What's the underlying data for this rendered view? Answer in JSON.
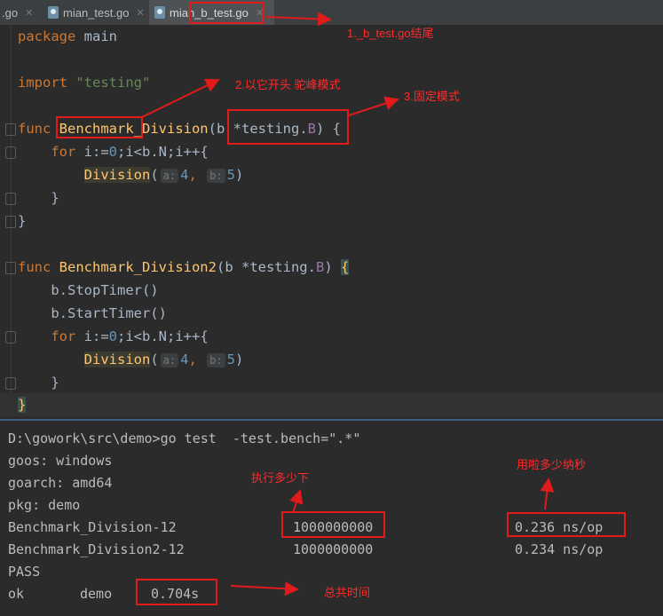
{
  "tabs": [
    {
      "label": ".go"
    },
    {
      "label": "mian_test.go"
    },
    {
      "label": "mian_b_test.go"
    }
  ],
  "code": {
    "l1": [
      "package",
      "main"
    ],
    "l3": [
      "import",
      "\"testing\""
    ],
    "f1_sig": [
      "func",
      "Benchmark_Division",
      "(b ",
      "*testing",
      ".",
      "B",
      ") {"
    ],
    "for1": [
      "for",
      " i:=",
      "0",
      ";i<b.N;i++{"
    ],
    "div1": [
      "Division",
      "(",
      "a:",
      "4",
      ",",
      "b:",
      "5",
      ")"
    ],
    "close_inner": "}",
    "close_outer": "}",
    "f2_sig": [
      "func",
      "Benchmark_Division2",
      "(b ",
      "*testing",
      ".",
      "B",
      ") ",
      "{"
    ],
    "stop": "b.StopTimer()",
    "start": "b.StartTimer()",
    "for2": [
      "for",
      " i:=",
      "0",
      ";i<b.N;i++{"
    ],
    "div2": [
      "Division",
      "(",
      "a:",
      "4",
      ",",
      "b:",
      "5",
      ")"
    ]
  },
  "terminal": {
    "cmd": "D:\\gowork\\src\\demo>go test  -test.bench=\".*\"",
    "goos": "goos: windows",
    "goarch": "goarch: amd64",
    "pkg": "pkg: demo",
    "rows": [
      {
        "name": "Benchmark_Division-12",
        "iters": "1000000000",
        "speed": "0.236 ns/op"
      },
      {
        "name": "Benchmark_Division2-12",
        "iters": "1000000000",
        "speed": "0.234 ns/op"
      }
    ],
    "pass": "PASS",
    "ok": "ok",
    "pkgname": "demo",
    "time": "0.704s"
  },
  "annotations": {
    "a1": "1._b_test.go结尾",
    "a2": "2.以它开头 驼峰模式",
    "a3": "3.固定模式",
    "a4": "执行多少下",
    "a5": "用啦多少纳秒",
    "a6": "总共时间"
  },
  "colors": {
    "annotation": "#e01b1b",
    "keyword": "#cc7832",
    "function": "#ffc66d",
    "string": "#6a8759",
    "number": "#6897bb"
  }
}
